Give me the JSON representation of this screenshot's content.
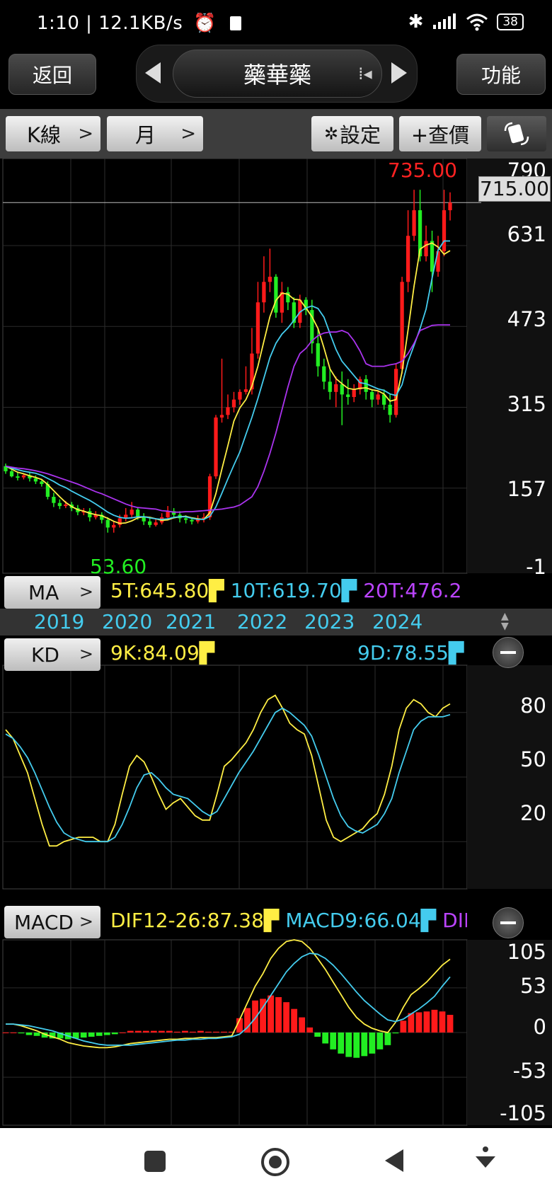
{
  "status": {
    "time": "1:10",
    "speed": "12.1KB/s",
    "battery": "38"
  },
  "header": {
    "back_label": "返回",
    "title": "藥華藥",
    "func_label": "功能"
  },
  "toolbar": {
    "kline_label": "K線",
    "period_label": "月",
    "settings_label": "設定",
    "quote_label": "+查價"
  },
  "price_chart": {
    "high_label": "735.00",
    "low_label": "53.60",
    "current": "715.00",
    "axis": [
      "790",
      "631",
      "473",
      "315",
      "157",
      "-1"
    ],
    "ma": {
      "label": "MA",
      "ma5": "5T:645.80",
      "ma10": "10T:619.70",
      "ma20": "20T:476.2"
    }
  },
  "years": [
    "2019",
    "2020",
    "2021",
    "2022",
    "2023",
    "2024"
  ],
  "kd": {
    "label": "KD",
    "k": "9K:84.09",
    "d": "9D:78.55",
    "axis": [
      "80",
      "50",
      "20"
    ]
  },
  "macd": {
    "label": "MACD",
    "dif": "DIF12-26:87.38",
    "macd9": "MACD9:66.04",
    "osc": "DII",
    "axis": [
      "105",
      "53",
      "0",
      "-53",
      "-105"
    ]
  },
  "colors": {
    "up": "#ff1a1a",
    "down": "#22ee22",
    "ma5": "#ffee44",
    "ma10": "#44ccee",
    "ma20": "#aa33ee"
  },
  "chart_data": [
    {
      "type": "candlestick",
      "title": "",
      "xlabel": "",
      "ylabel": "",
      "ylim": [
        -1,
        790
      ],
      "x_ticks": [
        "2019",
        "2020",
        "2021",
        "2022",
        "2023",
        "2024"
      ],
      "candles": [
        [
          200,
          190,
          205,
          185
        ],
        [
          190,
          180,
          197,
          178
        ],
        [
          180,
          178,
          188,
          172
        ],
        [
          178,
          182,
          186,
          174
        ],
        [
          182,
          176,
          188,
          170
        ],
        [
          176,
          170,
          182,
          165
        ],
        [
          170,
          165,
          175,
          160
        ],
        [
          165,
          140,
          170,
          135
        ],
        [
          140,
          128,
          148,
          120
        ],
        [
          128,
          122,
          135,
          116
        ],
        [
          122,
          125,
          132,
          118
        ],
        [
          125,
          118,
          130,
          112
        ],
        [
          118,
          110,
          124,
          104
        ],
        [
          110,
          112,
          118,
          104
        ],
        [
          112,
          100,
          118,
          92
        ],
        [
          100,
          105,
          112,
          96
        ],
        [
          105,
          95,
          110,
          88
        ],
        [
          95,
          80,
          100,
          70
        ],
        [
          80,
          85,
          92,
          70
        ],
        [
          85,
          98,
          105,
          80
        ],
        [
          98,
          105,
          118,
          92
        ],
        [
          105,
          115,
          130,
          100
        ],
        [
          115,
          102,
          120,
          95
        ],
        [
          102,
          92,
          108,
          85
        ],
        [
          92,
          85,
          100,
          80
        ],
        [
          85,
          90,
          98,
          82
        ],
        [
          90,
          100,
          108,
          86
        ],
        [
          100,
          112,
          122,
          95
        ],
        [
          112,
          105,
          118,
          98
        ],
        [
          105,
          98,
          112,
          90
        ],
        [
          98,
          95,
          104,
          88
        ],
        [
          95,
          92,
          100,
          86
        ],
        [
          92,
          98,
          104,
          88
        ],
        [
          98,
          100,
          108,
          90
        ],
        [
          100,
          180,
          185,
          95
        ],
        [
          180,
          295,
          300,
          175
        ],
        [
          295,
          300,
          410,
          285
        ],
        [
          300,
          315,
          340,
          292
        ],
        [
          315,
          330,
          345,
          305
        ],
        [
          330,
          345,
          350,
          320
        ],
        [
          345,
          350,
          395,
          340
        ],
        [
          350,
          420,
          470,
          340
        ],
        [
          420,
          520,
          560,
          410
        ],
        [
          520,
          560,
          610,
          500
        ],
        [
          560,
          570,
          625,
          540
        ],
        [
          570,
          500,
          575,
          490
        ],
        [
          500,
          540,
          560,
          480
        ],
        [
          540,
          520,
          550,
          505
        ],
        [
          520,
          480,
          530,
          470
        ],
        [
          480,
          525,
          535,
          470
        ],
        [
          525,
          505,
          530,
          495
        ],
        [
          505,
          440,
          525,
          420
        ],
        [
          440,
          395,
          470,
          375
        ],
        [
          395,
          365,
          410,
          350
        ],
        [
          365,
          345,
          390,
          330
        ],
        [
          345,
          360,
          375,
          315
        ],
        [
          360,
          340,
          385,
          280
        ],
        [
          340,
          335,
          370,
          320
        ],
        [
          335,
          350,
          360,
          325
        ],
        [
          350,
          370,
          375,
          340
        ],
        [
          370,
          345,
          378,
          330
        ],
        [
          345,
          330,
          350,
          315
        ],
        [
          330,
          340,
          348,
          320
        ],
        [
          340,
          320,
          350,
          310
        ],
        [
          320,
          300,
          340,
          285
        ],
        [
          300,
          390,
          400,
          295
        ],
        [
          390,
          560,
          570,
          380
        ],
        [
          560,
          650,
          700,
          540
        ],
        [
          650,
          700,
          740,
          640
        ],
        [
          700,
          610,
          740,
          600
        ],
        [
          610,
          640,
          670,
          600
        ],
        [
          640,
          580,
          660,
          540
        ],
        [
          580,
          620,
          650,
          570
        ],
        [
          620,
          700,
          740,
          610
        ],
        [
          700,
          715,
          735,
          680
        ]
      ],
      "series": [
        {
          "name": "5T",
          "values": [
            200,
            194,
            188,
            185,
            181,
            178,
            174,
            164,
            152,
            140,
            129,
            121,
            115,
            112,
            108,
            105,
            103,
            98,
            92,
            88,
            89,
            93,
            99,
            101,
            100,
            97,
            94,
            95,
            99,
            101,
            102,
            99,
            97,
            96,
            109,
            146,
            194,
            240,
            288,
            314,
            330,
            356,
            395,
            444,
            492,
            524,
            538,
            536,
            526,
            525,
            509,
            492,
            469,
            431,
            390,
            371,
            361,
            352,
            350,
            352,
            353,
            349,
            347,
            341,
            327,
            330,
            384,
            466,
            552,
            624,
            632,
            636,
            628,
            614,
            621
          ]
        },
        {
          "name": "10T",
          "values": [
            200,
            196,
            193,
            190,
            188,
            186,
            182,
            176,
            170,
            163,
            158,
            151,
            145,
            139,
            133,
            126,
            118,
            110,
            104,
            100,
            98,
            99,
            101,
            101,
            99,
            97,
            96,
            97,
            100,
            101,
            101,
            98,
            96,
            96,
            102,
            120,
            147,
            175,
            202,
            228,
            262,
            295,
            332,
            372,
            412,
            440,
            458,
            470,
            485,
            501,
            509,
            513,
            508,
            491,
            459,
            428,
            405,
            391,
            377,
            363,
            361,
            356,
            351,
            348,
            341,
            338,
            359,
            404,
            436,
            469,
            507,
            567,
            622,
            640,
            640
          ]
        },
        {
          "name": "20T",
          "values": [
            200,
            198,
            196,
            195,
            193,
            191,
            188,
            185,
            181,
            177,
            173,
            169,
            165,
            160,
            155,
            150,
            146,
            141,
            136,
            131,
            126,
            122,
            119,
            118,
            117,
            116,
            113,
            112,
            110,
            110,
            111,
            111,
            112,
            113,
            114,
            115,
            116,
            118,
            120,
            124,
            132,
            140,
            160,
            190,
            225,
            265,
            310,
            355,
            395,
            420,
            430,
            445,
            455,
            460,
            462,
            462,
            465,
            460,
            445,
            425,
            400,
            395,
            395,
            395,
            398,
            400,
            405,
            420,
            440,
            465,
            470,
            475,
            476,
            476,
            476
          ]
        }
      ]
    },
    {
      "type": "line",
      "title": "",
      "xlabel": "",
      "ylabel": "",
      "ylim": [
        0,
        100
      ],
      "series": [
        {
          "name": "9K",
          "values": [
            72,
            68,
            60,
            52,
            40,
            28,
            18,
            18,
            20,
            21,
            22,
            22,
            22,
            20,
            20,
            28,
            42,
            55,
            60,
            57,
            50,
            42,
            35,
            38,
            40,
            36,
            32,
            30,
            30,
            42,
            55,
            58,
            62,
            66,
            72,
            80,
            86,
            88,
            82,
            75,
            72,
            70,
            60,
            45,
            30,
            22,
            20,
            22,
            24,
            26,
            30,
            33,
            42,
            55,
            72,
            82,
            86,
            84,
            80,
            78,
            82,
            84
          ]
        },
        {
          "name": "9D",
          "values": [
            70,
            68,
            64,
            59,
            52,
            44,
            36,
            29,
            24,
            22,
            21,
            20,
            20,
            20,
            20,
            22,
            28,
            36,
            45,
            51,
            52,
            49,
            45,
            42,
            41,
            40,
            37,
            34,
            32,
            34,
            40,
            46,
            52,
            57,
            62,
            68,
            74,
            80,
            82,
            80,
            77,
            74,
            69,
            60,
            50,
            40,
            32,
            27,
            25,
            24,
            26,
            28,
            33,
            40,
            52,
            62,
            72,
            76,
            78,
            78,
            78,
            79
          ]
        }
      ]
    },
    {
      "type": "bar",
      "title": "",
      "xlabel": "",
      "ylabel": "",
      "ylim": [
        -105,
        105
      ],
      "series": [
        {
          "name": "DIF12-26",
          "values": [
            10,
            10,
            8,
            5,
            2,
            -2,
            -5,
            -8,
            -12,
            -14,
            -16,
            -17,
            -18,
            -18,
            -17,
            -15,
            -13,
            -12,
            -11,
            -10,
            -9,
            -8,
            -8,
            -7,
            -7,
            -6,
            -6,
            -6,
            -5,
            -4,
            15,
            35,
            55,
            70,
            88,
            100,
            108,
            110,
            108,
            100,
            88,
            75,
            60,
            45,
            30,
            18,
            10,
            5,
            2,
            0,
            12,
            30,
            45,
            52,
            60,
            70,
            80,
            87
          ]
        },
        {
          "name": "MACD9",
          "values": [
            10,
            10,
            9,
            8,
            6,
            4,
            2,
            -1,
            -4,
            -7,
            -10,
            -12,
            -14,
            -15,
            -15,
            -15,
            -15,
            -14,
            -13,
            -12,
            -11,
            -10,
            -9,
            -9,
            -8,
            -8,
            -7,
            -7,
            -6,
            -5,
            -2,
            6,
            17,
            30,
            44,
            58,
            72,
            82,
            90,
            94,
            93,
            88,
            80,
            70,
            59,
            48,
            38,
            30,
            22,
            15,
            13,
            16,
            22,
            28,
            35,
            43,
            55,
            66
          ]
        },
        {
          "name": "OSC",
          "values": [
            0,
            0,
            -1,
            -3,
            -4,
            -6,
            -7,
            -7,
            -8,
            -7,
            -6,
            -5,
            -4,
            -3,
            -2,
            0,
            2,
            2,
            2,
            2,
            2,
            2,
            1,
            2,
            1,
            2,
            1,
            1,
            1,
            1,
            17,
            29,
            38,
            40,
            44,
            42,
            36,
            28,
            18,
            6,
            -5,
            -13,
            -20,
            -25,
            -29,
            -30,
            -28,
            -25,
            -20,
            -15,
            -1,
            14,
            23,
            24,
            25,
            27,
            25,
            21
          ]
        }
      ]
    }
  ]
}
